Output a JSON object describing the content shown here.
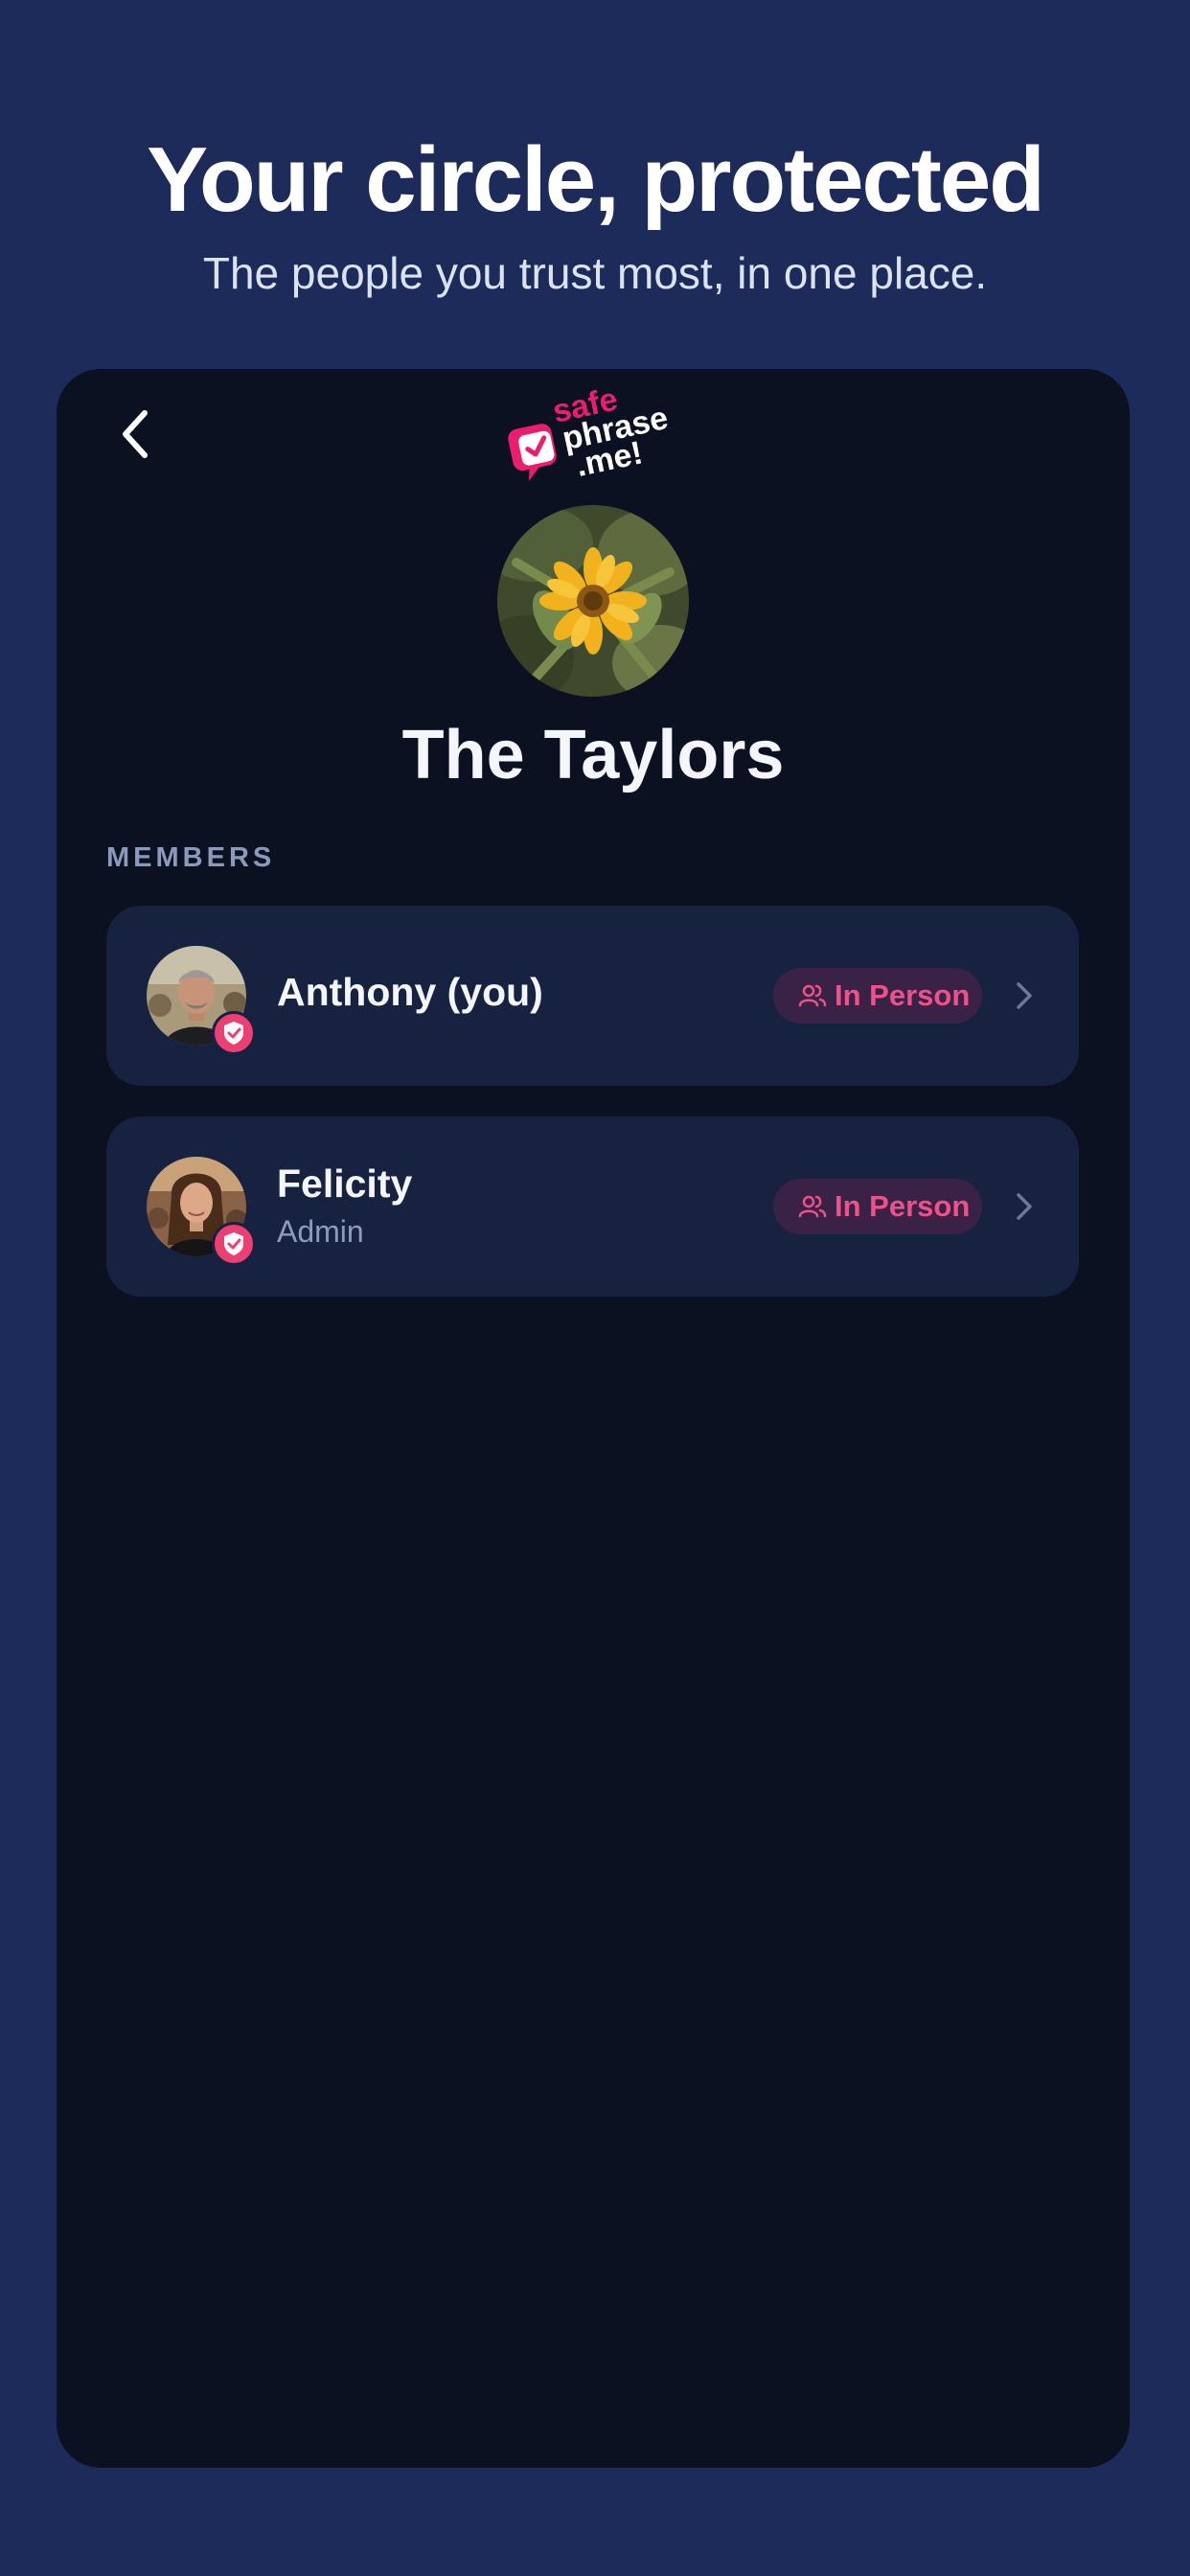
{
  "hero": {
    "title": "Your circle, protected",
    "subtitle": "The people you trust most, in one place."
  },
  "app": {
    "logo_text": [
      "safe",
      "phrase",
      ".me!"
    ],
    "back_icon": "chevron-left-icon"
  },
  "group": {
    "name": "The Taylors",
    "avatar": "sunflower-photo"
  },
  "members_section": {
    "label": "MEMBERS"
  },
  "members": [
    {
      "name": "Anthony  (you)",
      "role": "",
      "badge": "In Person",
      "avatar": "man-photo",
      "status_icon": "shield-check-icon"
    },
    {
      "name": "Felicity",
      "role": "Admin",
      "badge": "In Person",
      "avatar": "woman-photo",
      "status_icon": "shield-check-icon"
    }
  ],
  "colors": {
    "background": "#1c2b59",
    "phone_background": "#0b1120",
    "card_background": "#162240",
    "accent_pink": "#ec3f72",
    "badge_background": "#3a2246"
  }
}
